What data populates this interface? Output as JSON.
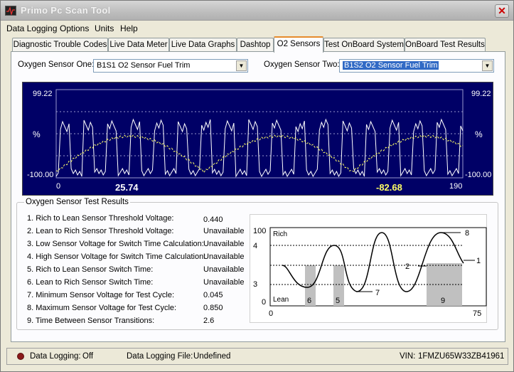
{
  "title": "Primo Pc  Scan  Tool",
  "menu": [
    "Data Logging",
    "Options",
    "Units",
    "Help"
  ],
  "tabs": [
    "Diagnostic Trouble Codes",
    "Live Data Meter",
    "Live Data Graphs",
    "Dashtop",
    "O2 Sensors",
    "Test OnBoard System",
    "OnBoard Test Results"
  ],
  "active_tab": "O2 Sensors",
  "sensor_one": {
    "label": "Oxygen Sensor One:",
    "value": "B1S1 O2 Sensor Fuel Trim"
  },
  "sensor_two": {
    "label": "Oxygen Sensor Two:",
    "value": "B1S2 O2 Sensor Fuel Trim"
  },
  "graph": {
    "y_max": "99.22",
    "y_min": "-100.00",
    "y_max_right": "99.22",
    "y_min_right": "-100.00",
    "unit_left": "%",
    "unit_right": "%",
    "x_min": "0",
    "x_max": "190",
    "value_one": "25.74",
    "value_two": "-82.68",
    "color_one": "#ffffff",
    "color_two": "#ffff66",
    "background": "#000066"
  },
  "results": {
    "title": "Oxygen Sensor Test Results",
    "rows": [
      {
        "label": "1. Rich to Lean Sensor Threshold Voltage:",
        "value": "0.440"
      },
      {
        "label": "2. Lean to Rich Sensor Threshold Voltage:",
        "value": "Unavailable"
      },
      {
        "label": "3. Low Sensor Voltage for Switch Time Calculation:",
        "value": "Unavailable"
      },
      {
        "label": "4. High Sensor Voltage for Switch Time Calculation:",
        "value": "Unavailable"
      },
      {
        "label": "5. Rich to Lean Sensor Switch Time:",
        "value": "Unavailable"
      },
      {
        "label": "6. Lean to Rich Sensor Switch Time:",
        "value": "Unavailable"
      },
      {
        "label": "7. Minimum Sensor Voltage for Test Cycle:",
        "value": "0.045"
      },
      {
        "label": "8. Maximum Sensor Voltage for Test Cycle:",
        "value": "0.850"
      },
      {
        "label": "9. Time Between Sensor Transitions:",
        "value": "2.6"
      }
    ]
  },
  "diagram": {
    "y_top": "100",
    "y_zero": "0",
    "x_zero": "0",
    "x_end": "75",
    "rich": "Rich",
    "lean": "Lean",
    "marks": [
      "1",
      "2",
      "3",
      "4",
      "5",
      "6",
      "7",
      "8",
      "9"
    ]
  },
  "status": {
    "logging_label": "Data Logging:",
    "logging_value": "Off",
    "file_label": "Data Logging File:",
    "file_value": "Undefined",
    "vin_label": "VIN:",
    "vin_value": "1FMZU65W33ZB41961"
  }
}
